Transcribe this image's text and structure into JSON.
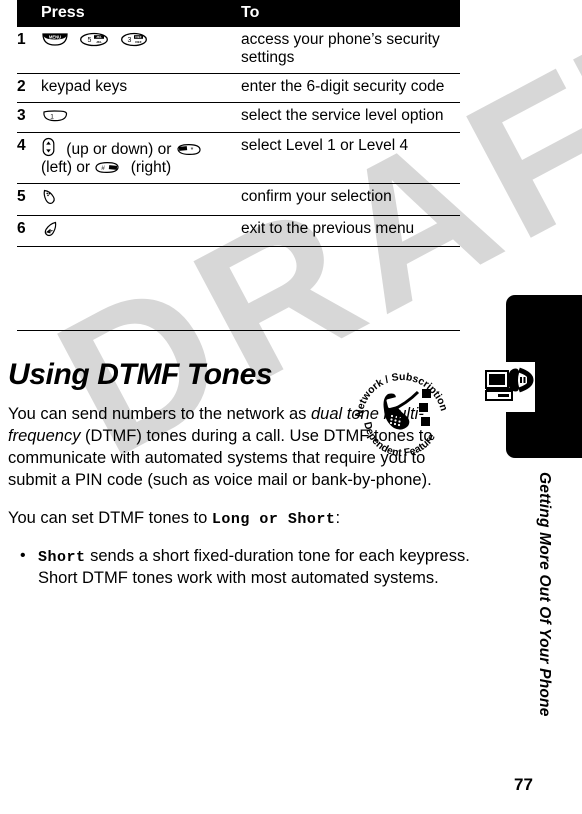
{
  "document": {
    "watermark_text": "DRAFT",
    "page_number": "77",
    "chapter_label": "Getting More Out Of Your Phone"
  },
  "table": {
    "headers": {
      "number": "",
      "press": "Press",
      "to": "To"
    },
    "rows": [
      {
        "number": "1",
        "press_text": "",
        "press_keys": [
          "menu-key",
          "5-jkl-key",
          "3-def-key"
        ],
        "to": "access your phone’s security settings"
      },
      {
        "number": "2",
        "press_text": "keypad keys",
        "press_keys": [],
        "to": "enter the 6-digit security code"
      },
      {
        "number": "3",
        "press_text": "",
        "press_keys": [
          "1-key"
        ],
        "to": "select the service level option"
      },
      {
        "number": "4",
        "press_text": "",
        "press_keys": [
          "nav-updown-key",
          "star-key",
          "pound-key"
        ],
        "press_inline": [
          {
            "key": "nav-updown-key"
          },
          {
            "text": " (up or down) or "
          },
          {
            "key": "star-key"
          },
          {
            "text": " (left) or "
          },
          {
            "key": "pound-key"
          },
          {
            "text": " (right)"
          }
        ],
        "to": "select Level 1 or Level 4"
      },
      {
        "number": "5",
        "press_text": "",
        "press_keys": [
          "softkey-select"
        ],
        "to": "confirm your selection"
      },
      {
        "number": "6",
        "press_text": "",
        "press_keys": [
          "back-key"
        ],
        "to": "exit to the previous menu"
      }
    ]
  },
  "section": {
    "heading": "Using DTMF Tones",
    "paragraph_1_part_1": "You can send numbers to the network as ",
    "paragraph_1_italic": "dual tone multi-frequency",
    "paragraph_1_part_2": " (DTMF) tones during a call. Use DTMF tones to communicate with automated systems that require you to submit a PIN code (such as voice mail or bank-by-phone).",
    "paragraph_2_part_1": "You can set DTMF tones to ",
    "paragraph_2_mono": "Long or Short",
    "paragraph_2_part_2": ":",
    "bullets": [
      {
        "mono_lead": "Short",
        "text": " sends a short fixed-duration tone for each keypress. Short DTMF tones work with most automated systems."
      }
    ]
  },
  "badge": {
    "name": "network-subscription-dependent-feature",
    "text_top": "Network / Subscription",
    "text_bottom": "Dependent  Feature"
  },
  "colors": {
    "header_bar": "#000000",
    "header_text": "#ffffff",
    "page_background": "#ffffff",
    "watermark": "#d7d7d7",
    "tab": "#000000"
  }
}
